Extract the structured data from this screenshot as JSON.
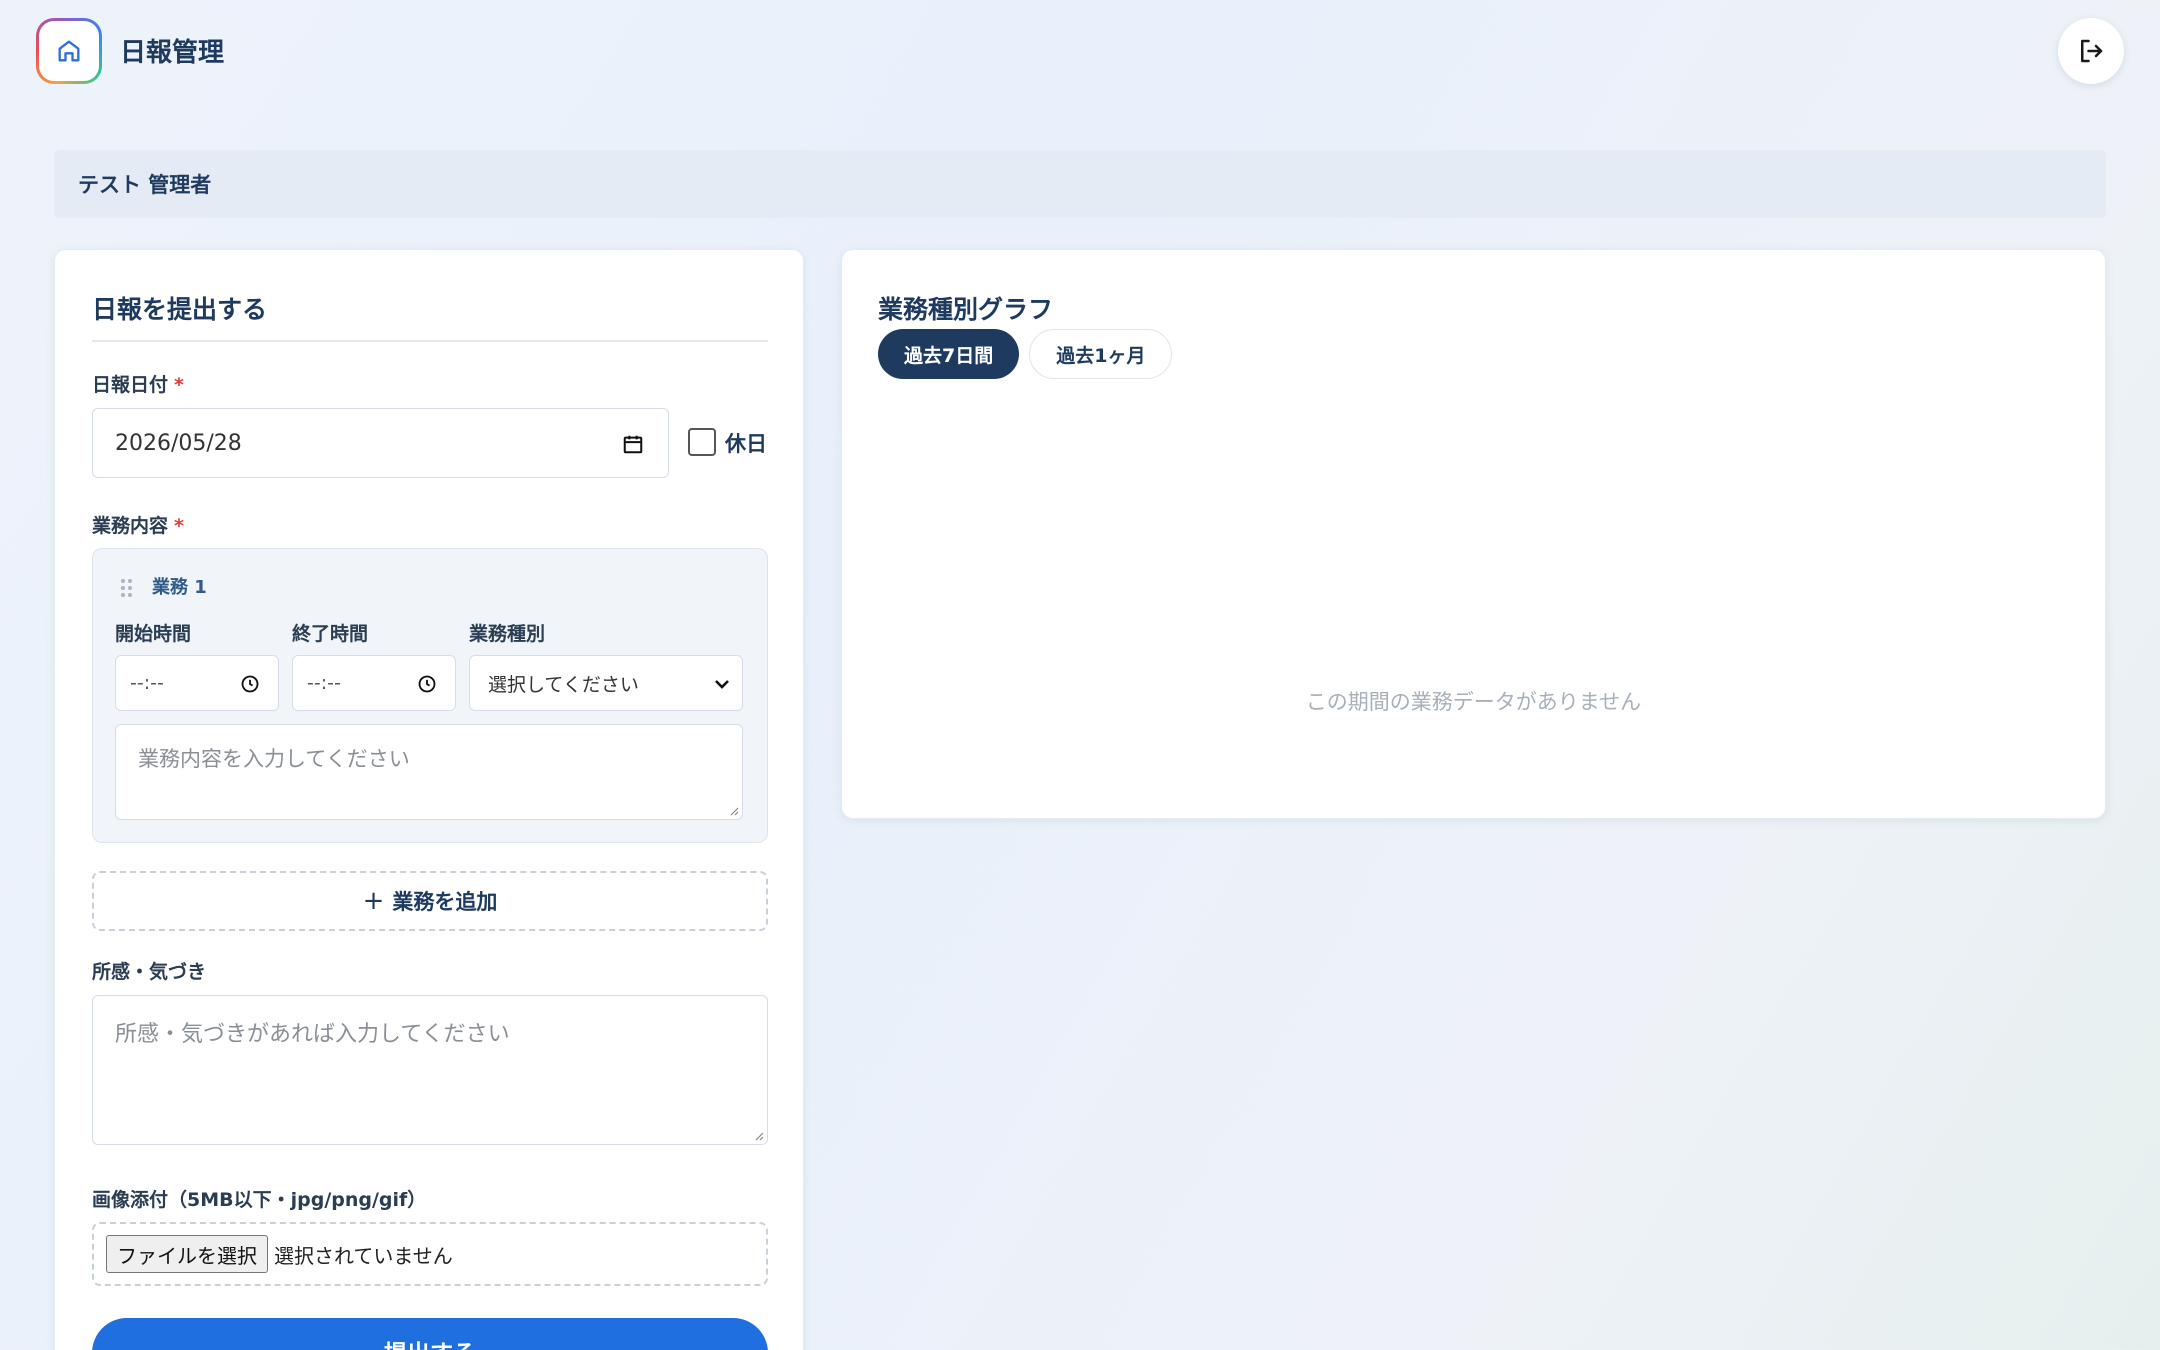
{
  "header": {
    "app_title": "日報管理",
    "logo_icon": "home-icon",
    "logout_icon": "logout-icon"
  },
  "user": {
    "name": "テスト 管理者"
  },
  "form": {
    "title": "日報を提出する",
    "date_label": "日報日付",
    "required_mark": "*",
    "date_value": "2026/05/28",
    "holiday_label": "休日",
    "holiday_checked": false,
    "tasks_label": "業務内容",
    "task": {
      "title": "業務 1",
      "start_label": "開始時間",
      "end_label": "終了時間",
      "type_label": "業務種別",
      "start_value": "--:--",
      "end_value": "--:--",
      "type_selected": "選択してください",
      "content_placeholder": "業務内容を入力してください"
    },
    "add_task_label": "業務を追加",
    "notes_label": "所感・気づき",
    "notes_placeholder": "所感・気づきがあれば入力してください",
    "image_label": "画像添付（5MB以下・jpg/png/gif）",
    "file_button": "ファイルを選択",
    "file_status": "選択されていません",
    "submit_label": "提出する"
  },
  "chart": {
    "title": "業務種別グラフ",
    "tabs": [
      {
        "label": "過去7日間",
        "active": true
      },
      {
        "label": "過去1ヶ月",
        "active": false
      }
    ],
    "empty_message": "この期間の業務データがありません"
  },
  "colors": {
    "primary": "#1e3a5f",
    "accent": "#1f6fe0",
    "required": "#e53935"
  }
}
